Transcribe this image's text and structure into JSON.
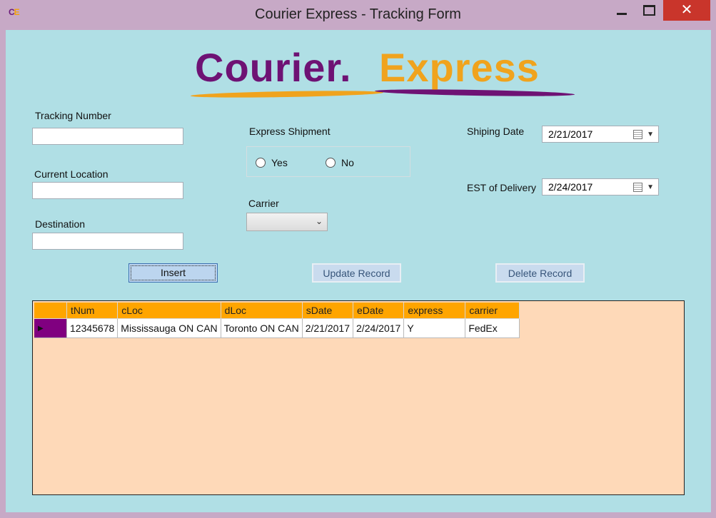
{
  "window": {
    "title": "Courier Express - Tracking Form",
    "icon_text_1": "C",
    "icon_text_2": "E",
    "close_glyph": "✕"
  },
  "logo": {
    "part1": "Courier.",
    "part2": "Express"
  },
  "form": {
    "tracking_number_label": "Tracking Number",
    "tracking_number_value": "",
    "current_location_label": "Current Location",
    "current_location_value": "",
    "destination_label": "Destination",
    "destination_value": "",
    "express_label": "Express Shipment",
    "express_yes": "Yes",
    "express_no": "No",
    "carrier_label": "Carrier",
    "carrier_value": "",
    "shipping_date_label": "Shiping Date",
    "shipping_date_value": "2/21/2017",
    "est_delivery_label": "EST of Delivery",
    "est_delivery_value": "2/24/2017"
  },
  "buttons": {
    "insert": "Insert",
    "update": "Update Record",
    "delete": "Delete Record"
  },
  "grid": {
    "columns": [
      "tNum",
      "cLoc",
      "dLoc",
      "sDate",
      "eDate",
      "express",
      "carrier"
    ],
    "rows": [
      [
        "12345678",
        "Mississauga ON CAN",
        "Toronto ON CAN",
        "2/21/2017",
        "2/24/2017",
        "Y",
        "FedEx"
      ]
    ],
    "selected_row_marker": "▶"
  },
  "colors": {
    "client_bg": "#b0dfe5",
    "grid_bg": "#fed9b8",
    "header_bg": "#ffa500",
    "selected_marker_bg": "#800080"
  }
}
